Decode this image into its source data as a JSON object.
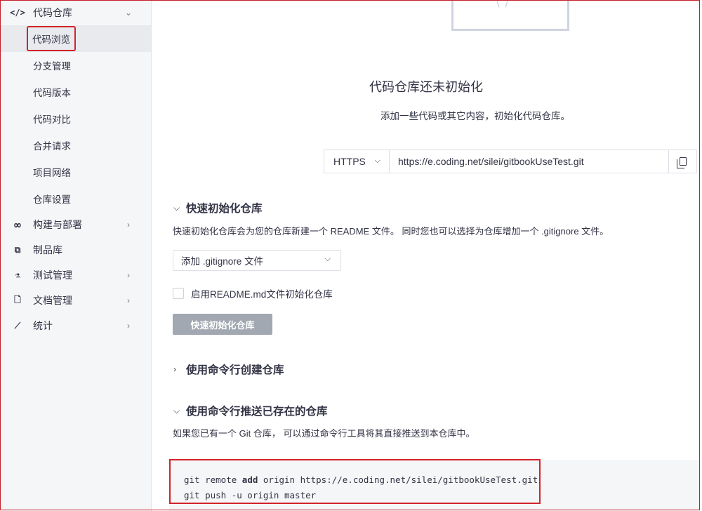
{
  "sidebar": {
    "repo_group": {
      "label": "代码仓库",
      "icon": "code-icon",
      "glyph": "</>"
    },
    "repo_items": [
      {
        "label": "代码浏览",
        "active": true
      },
      {
        "label": "分支管理"
      },
      {
        "label": "代码版本"
      },
      {
        "label": "代码对比"
      },
      {
        "label": "合并请求"
      },
      {
        "label": "项目网络"
      },
      {
        "label": "仓库设置"
      }
    ],
    "groups": [
      {
        "label": "构建与部署",
        "icon": "infinity-icon",
        "glyph": "∞",
        "chevron": true
      },
      {
        "label": "制品库",
        "icon": "package-icon",
        "glyph": "⧉",
        "chevron": false
      },
      {
        "label": "测试管理",
        "icon": "flask-icon",
        "glyph": "⚗",
        "chevron": true
      },
      {
        "label": "文档管理",
        "icon": "document-icon",
        "glyph": "🗋",
        "chevron": true
      },
      {
        "label": "统计",
        "icon": "chart-icon",
        "glyph": "⟋",
        "chevron": true
      }
    ]
  },
  "main": {
    "empty_title": "代码仓库还未初始化",
    "empty_desc": "添加一些代码或其它内容，初始化代码仓库。",
    "clone": {
      "protocol": "HTTPS",
      "url": "https://e.coding.net/silei/gitbookUseTest.git"
    },
    "quick_init": {
      "heading": "快速初始化仓库",
      "desc": "快速初始化仓库会为您的仓库新建一个 README 文件。 同时您也可以选择为仓库增加一个 .gitignore 文件。",
      "gitignore_select": "添加 .gitignore 文件",
      "readme_checkbox": "启用README.md文件初始化仓库",
      "button": "快速初始化仓库"
    },
    "cli_create": {
      "heading": "使用命令行创建仓库"
    },
    "cli_push": {
      "heading": "使用命令行推送已存在的仓库",
      "desc": "如果您已有一个 Git 仓库， 可以通过命令行工具将其直接推送到本仓库中。",
      "line1_pre": "git remote ",
      "line1_kw": "add",
      "line1_post": " origin https://e.coding.net/silei/gitbookUseTest.git",
      "line2": "git push -u origin master"
    }
  }
}
